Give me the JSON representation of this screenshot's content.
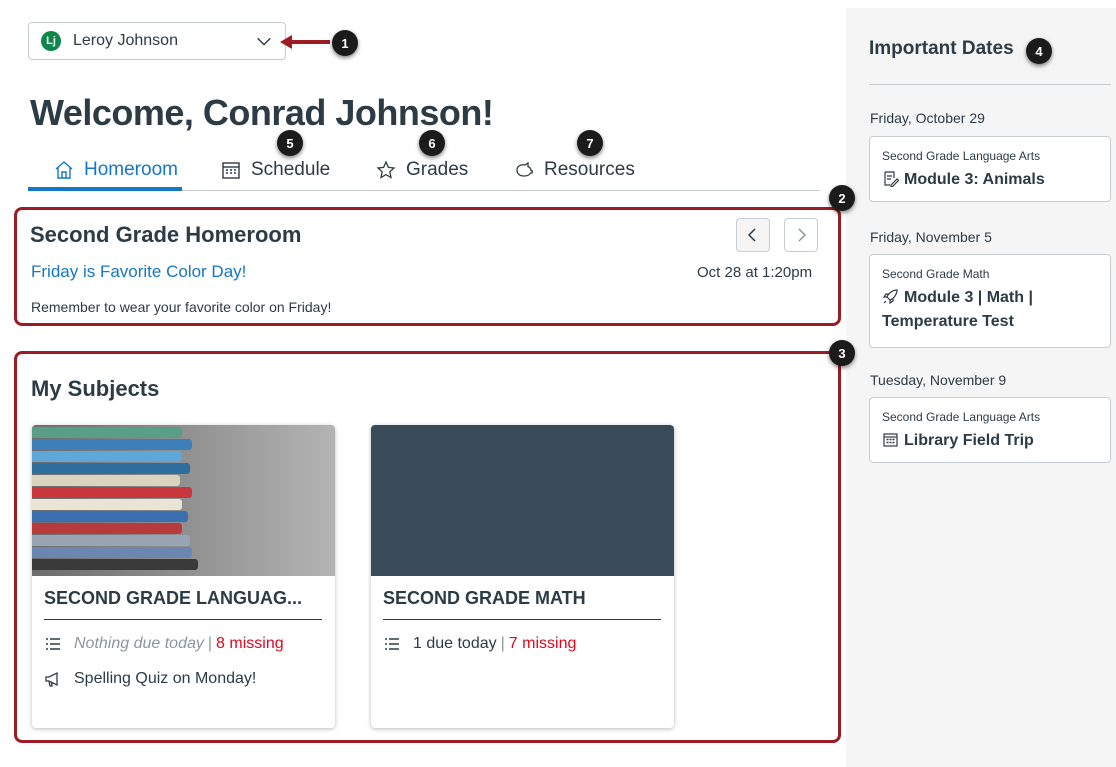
{
  "account": {
    "initial": "Lj",
    "name": "Leroy Johnson"
  },
  "welcome": "Welcome, Conrad Johnson!",
  "tabs": [
    {
      "label": "Homeroom",
      "icon": "home-icon",
      "active": true
    },
    {
      "label": "Schedule",
      "icon": "calendar-icon",
      "active": false
    },
    {
      "label": "Grades",
      "icon": "star-icon",
      "active": false
    },
    {
      "label": "Resources",
      "icon": "piggy-bank-icon",
      "active": false
    }
  ],
  "homeroom": {
    "title": "Second Grade Homeroom",
    "announcement": {
      "title": "Friday is Favorite Color Day!",
      "date": "Oct 28 at 1:20pm",
      "body": "Remember to wear your favorite color on Friday!"
    }
  },
  "subjects": {
    "title": "My Subjects",
    "cards": [
      {
        "title": "SECOND GRADE LANGUAG...",
        "due": "Nothing due today",
        "missing": "8 missing",
        "announcement": "Spelling Quiz on Monday!"
      },
      {
        "title": "SECOND GRADE MATH",
        "due": "1 due today",
        "missing": "7 missing",
        "color": "#394b58"
      }
    ]
  },
  "important_dates": {
    "title": "Important Dates",
    "groups": [
      {
        "date": "Friday, October 29",
        "course": "Second Grade Language Arts",
        "item_line1": "Module 3: Animals",
        "icon": "assignment-icon"
      },
      {
        "date": "Friday, November 5",
        "course": "Second Grade Math",
        "item_line1": "Module 3 | Math |",
        "item_line2": "Temperature Test",
        "icon": "quiz-rocket-icon"
      },
      {
        "date": "Tuesday, November 9",
        "course": "Second Grade Language Arts",
        "item_line1": "Library Field Trip",
        "icon": "calendar-icon"
      }
    ]
  },
  "callouts": [
    "1",
    "2",
    "3",
    "4",
    "5",
    "6",
    "7"
  ],
  "colors": {
    "accent": "#1477c5",
    "highlight": "#9b1c23",
    "missing": "#e0061f",
    "text": "#2d3b45"
  }
}
